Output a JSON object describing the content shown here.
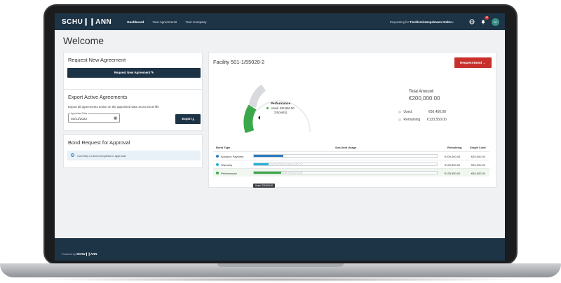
{
  "nav": {
    "logo": "SCHU❙❙ANN",
    "links": [
      "Dashboard",
      "Your Agreements",
      "Your Company"
    ],
    "requesting_label": "Requesting for",
    "requesting_company": "TischlereiHempelmann GmbH",
    "notification_count": "18",
    "avatar_initials": "AT"
  },
  "page_title": "Welcome",
  "request_card": {
    "title": "Request New Agreement",
    "button": "Request New Agreement"
  },
  "export_card": {
    "title": "Export Active Agreements",
    "description": "Export all agreements active on the appointed date as an Excel file",
    "date_label": "Appointed Date",
    "date_value": "02/21/2023",
    "button": "Export"
  },
  "bond_request_card": {
    "title": "Bond Request for Approval",
    "info_text": "Currently no bond requests in approval."
  },
  "facility": {
    "title": "Facility 501-1/55028-2",
    "request_button": "Request Bond",
    "gauge": {
      "label": "Performance",
      "used_text": "Used: €33,950.00",
      "bonds_text": "3 Bond(s)"
    },
    "total_label": "Total Amount:",
    "total_value": "€200,000.00",
    "used_label": "Used:",
    "used_value": "€66,450.00",
    "remaining_label": "Remaining",
    "remaining_value": "€133,550.00"
  },
  "table": {
    "headers": [
      "Bond Type",
      "Sub-limit Usage",
      "Remaining",
      "Single Limit"
    ],
    "rows": [
      {
        "type": "Advance Payment",
        "color": "#2a7bbf",
        "fill": 0.16,
        "hatch_start": 0.16,
        "hatch_end": 0.16,
        "remaining": "€105,000.00",
        "single": "€20,000.00"
      },
      {
        "type": "Warranty",
        "color": "#27b3d6",
        "fill": 0.08,
        "hatch_start": 0.08,
        "hatch_end": 0.27,
        "remaining": "€133,550.00",
        "single": "€20,000.00"
      },
      {
        "type": "Performance",
        "color": "#3aa84a",
        "fill": 0.15,
        "hatch_start": 0.15,
        "hatch_end": 0.27,
        "remaining": "€133,550.00",
        "single": "€40,000.00"
      }
    ],
    "tooltip": "Used: €33,950.00"
  },
  "footer": {
    "powered_by": "Powered by",
    "brand": "SCHU❙❙ANN"
  },
  "colors": {
    "navy": "#1d3447",
    "accent_red": "#c9302c",
    "performance_green": "#3aa84a",
    "used_gray": "#d8dadd"
  }
}
